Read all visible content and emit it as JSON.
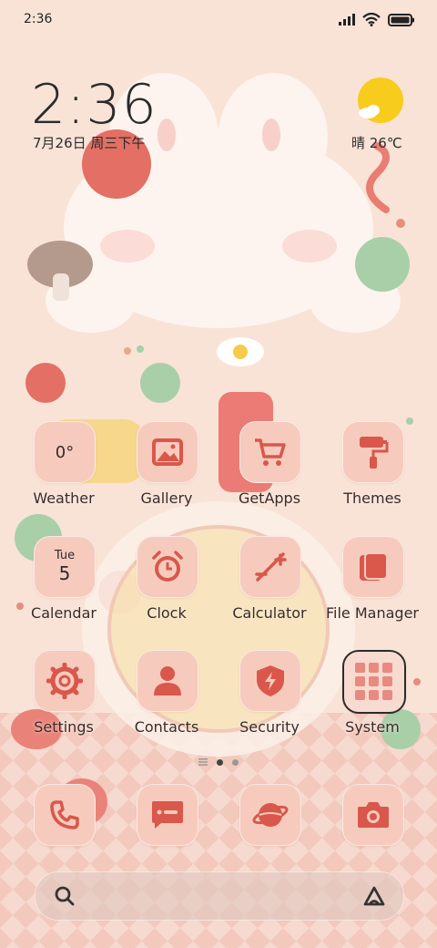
{
  "status_bar": {
    "time": "2:36",
    "icons": [
      "signal-icon",
      "wifi-icon",
      "battery-icon"
    ]
  },
  "widget": {
    "time": "2:36",
    "date": "7月26日 周三下午",
    "weather": "晴 26℃",
    "weather_icon": "sun-icon"
  },
  "apps": [
    {
      "label": "Weather",
      "icon": "weather-icon",
      "tile_text": "0°"
    },
    {
      "label": "Gallery",
      "icon": "gallery-icon"
    },
    {
      "label": "GetApps",
      "icon": "cart-icon"
    },
    {
      "label": "Themes",
      "icon": "paint-roller-icon"
    },
    {
      "label": "Calendar",
      "icon": "calendar-icon",
      "tile_day": "Tue",
      "tile_date": "5"
    },
    {
      "label": "Clock",
      "icon": "alarm-clock-icon"
    },
    {
      "label": "Calculator",
      "icon": "calculator-icon"
    },
    {
      "label": "File Manager",
      "icon": "folder-icon"
    },
    {
      "label": "Settings",
      "icon": "gear-icon"
    },
    {
      "label": "Contacts",
      "icon": "person-icon"
    },
    {
      "label": "Security",
      "icon": "shield-icon"
    },
    {
      "label": "System",
      "icon": "folder-grid-icon"
    }
  ],
  "dock": [
    {
      "name": "phone",
      "icon": "phone-icon"
    },
    {
      "name": "messages",
      "icon": "message-icon"
    },
    {
      "name": "browser",
      "icon": "planet-icon"
    },
    {
      "name": "camera",
      "icon": "camera-icon"
    }
  ],
  "pager": {
    "pages": 2,
    "current": 1
  },
  "search": {
    "left_icon": "search-icon",
    "right_icon": "assistant-icon"
  },
  "colors": {
    "background": "#f9e3d7",
    "tile": "#f6cbbd",
    "icon_red": "#d9574b",
    "sun": "#f7cc1c"
  }
}
